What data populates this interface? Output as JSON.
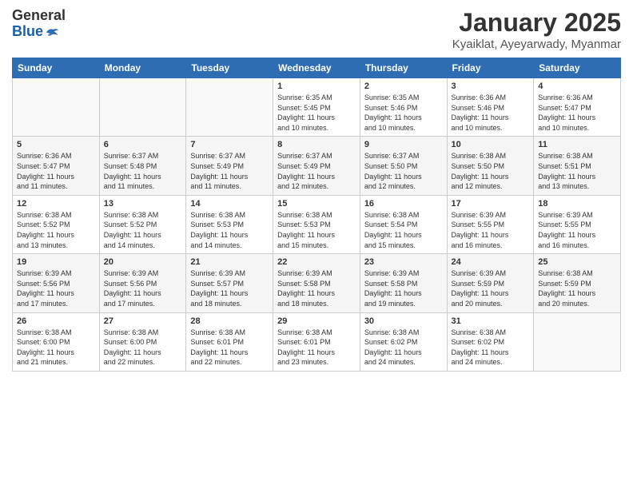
{
  "logo": {
    "general": "General",
    "blue": "Blue"
  },
  "header": {
    "title": "January 2025",
    "subtitle": "Kyaiklat, Ayeyarwady, Myanmar"
  },
  "weekdays": [
    "Sunday",
    "Monday",
    "Tuesday",
    "Wednesday",
    "Thursday",
    "Friday",
    "Saturday"
  ],
  "weeks": [
    [
      {
        "day": "",
        "lines": []
      },
      {
        "day": "",
        "lines": []
      },
      {
        "day": "",
        "lines": []
      },
      {
        "day": "1",
        "lines": [
          "Sunrise: 6:35 AM",
          "Sunset: 5:45 PM",
          "Daylight: 11 hours",
          "and 10 minutes."
        ]
      },
      {
        "day": "2",
        "lines": [
          "Sunrise: 6:35 AM",
          "Sunset: 5:46 PM",
          "Daylight: 11 hours",
          "and 10 minutes."
        ]
      },
      {
        "day": "3",
        "lines": [
          "Sunrise: 6:36 AM",
          "Sunset: 5:46 PM",
          "Daylight: 11 hours",
          "and 10 minutes."
        ]
      },
      {
        "day": "4",
        "lines": [
          "Sunrise: 6:36 AM",
          "Sunset: 5:47 PM",
          "Daylight: 11 hours",
          "and 10 minutes."
        ]
      }
    ],
    [
      {
        "day": "5",
        "lines": [
          "Sunrise: 6:36 AM",
          "Sunset: 5:47 PM",
          "Daylight: 11 hours",
          "and 11 minutes."
        ]
      },
      {
        "day": "6",
        "lines": [
          "Sunrise: 6:37 AM",
          "Sunset: 5:48 PM",
          "Daylight: 11 hours",
          "and 11 minutes."
        ]
      },
      {
        "day": "7",
        "lines": [
          "Sunrise: 6:37 AM",
          "Sunset: 5:49 PM",
          "Daylight: 11 hours",
          "and 11 minutes."
        ]
      },
      {
        "day": "8",
        "lines": [
          "Sunrise: 6:37 AM",
          "Sunset: 5:49 PM",
          "Daylight: 11 hours",
          "and 12 minutes."
        ]
      },
      {
        "day": "9",
        "lines": [
          "Sunrise: 6:37 AM",
          "Sunset: 5:50 PM",
          "Daylight: 11 hours",
          "and 12 minutes."
        ]
      },
      {
        "day": "10",
        "lines": [
          "Sunrise: 6:38 AM",
          "Sunset: 5:50 PM",
          "Daylight: 11 hours",
          "and 12 minutes."
        ]
      },
      {
        "day": "11",
        "lines": [
          "Sunrise: 6:38 AM",
          "Sunset: 5:51 PM",
          "Daylight: 11 hours",
          "and 13 minutes."
        ]
      }
    ],
    [
      {
        "day": "12",
        "lines": [
          "Sunrise: 6:38 AM",
          "Sunset: 5:52 PM",
          "Daylight: 11 hours",
          "and 13 minutes."
        ]
      },
      {
        "day": "13",
        "lines": [
          "Sunrise: 6:38 AM",
          "Sunset: 5:52 PM",
          "Daylight: 11 hours",
          "and 14 minutes."
        ]
      },
      {
        "day": "14",
        "lines": [
          "Sunrise: 6:38 AM",
          "Sunset: 5:53 PM",
          "Daylight: 11 hours",
          "and 14 minutes."
        ]
      },
      {
        "day": "15",
        "lines": [
          "Sunrise: 6:38 AM",
          "Sunset: 5:53 PM",
          "Daylight: 11 hours",
          "and 15 minutes."
        ]
      },
      {
        "day": "16",
        "lines": [
          "Sunrise: 6:38 AM",
          "Sunset: 5:54 PM",
          "Daylight: 11 hours",
          "and 15 minutes."
        ]
      },
      {
        "day": "17",
        "lines": [
          "Sunrise: 6:39 AM",
          "Sunset: 5:55 PM",
          "Daylight: 11 hours",
          "and 16 minutes."
        ]
      },
      {
        "day": "18",
        "lines": [
          "Sunrise: 6:39 AM",
          "Sunset: 5:55 PM",
          "Daylight: 11 hours",
          "and 16 minutes."
        ]
      }
    ],
    [
      {
        "day": "19",
        "lines": [
          "Sunrise: 6:39 AM",
          "Sunset: 5:56 PM",
          "Daylight: 11 hours",
          "and 17 minutes."
        ]
      },
      {
        "day": "20",
        "lines": [
          "Sunrise: 6:39 AM",
          "Sunset: 5:56 PM",
          "Daylight: 11 hours",
          "and 17 minutes."
        ]
      },
      {
        "day": "21",
        "lines": [
          "Sunrise: 6:39 AM",
          "Sunset: 5:57 PM",
          "Daylight: 11 hours",
          "and 18 minutes."
        ]
      },
      {
        "day": "22",
        "lines": [
          "Sunrise: 6:39 AM",
          "Sunset: 5:58 PM",
          "Daylight: 11 hours",
          "and 18 minutes."
        ]
      },
      {
        "day": "23",
        "lines": [
          "Sunrise: 6:39 AM",
          "Sunset: 5:58 PM",
          "Daylight: 11 hours",
          "and 19 minutes."
        ]
      },
      {
        "day": "24",
        "lines": [
          "Sunrise: 6:39 AM",
          "Sunset: 5:59 PM",
          "Daylight: 11 hours",
          "and 20 minutes."
        ]
      },
      {
        "day": "25",
        "lines": [
          "Sunrise: 6:38 AM",
          "Sunset: 5:59 PM",
          "Daylight: 11 hours",
          "and 20 minutes."
        ]
      }
    ],
    [
      {
        "day": "26",
        "lines": [
          "Sunrise: 6:38 AM",
          "Sunset: 6:00 PM",
          "Daylight: 11 hours",
          "and 21 minutes."
        ]
      },
      {
        "day": "27",
        "lines": [
          "Sunrise: 6:38 AM",
          "Sunset: 6:00 PM",
          "Daylight: 11 hours",
          "and 22 minutes."
        ]
      },
      {
        "day": "28",
        "lines": [
          "Sunrise: 6:38 AM",
          "Sunset: 6:01 PM",
          "Daylight: 11 hours",
          "and 22 minutes."
        ]
      },
      {
        "day": "29",
        "lines": [
          "Sunrise: 6:38 AM",
          "Sunset: 6:01 PM",
          "Daylight: 11 hours",
          "and 23 minutes."
        ]
      },
      {
        "day": "30",
        "lines": [
          "Sunrise: 6:38 AM",
          "Sunset: 6:02 PM",
          "Daylight: 11 hours",
          "and 24 minutes."
        ]
      },
      {
        "day": "31",
        "lines": [
          "Sunrise: 6:38 AM",
          "Sunset: 6:02 PM",
          "Daylight: 11 hours",
          "and 24 minutes."
        ]
      },
      {
        "day": "",
        "lines": []
      }
    ]
  ]
}
